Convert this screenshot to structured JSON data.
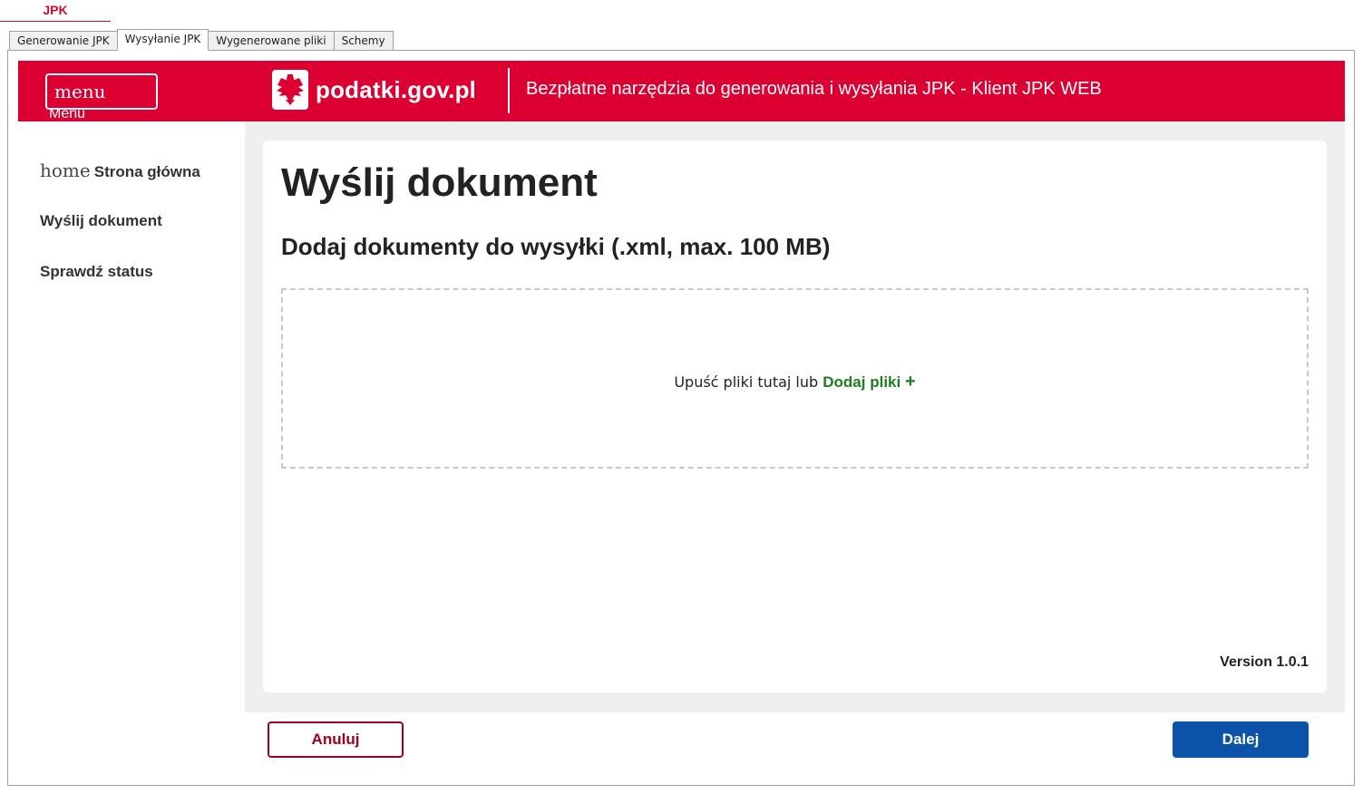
{
  "app_tab": {
    "label": "JPK"
  },
  "subtabs": [
    {
      "label": "Generowanie JPK"
    },
    {
      "label": "Wysyłanie JPK"
    },
    {
      "label": "Wygenerowane pliki"
    },
    {
      "label": "Schemy"
    }
  ],
  "header": {
    "menu_icon_text": "menu",
    "menu_label": "Menu",
    "logo_text": "podatki.gov.pl",
    "title": "Bezpłatne narzędzia do generowania i wysyłania JPK - Klient JPK WEB",
    "background_color": "#dc0032"
  },
  "sidebar": {
    "items": [
      {
        "icon_text": "home",
        "label": "Strona główna"
      },
      {
        "label": "Wyślij dokument"
      },
      {
        "label": "Sprawdź status"
      }
    ]
  },
  "main": {
    "title": "Wyślij dokument",
    "subtitle": "Dodaj dokumenty do wysyłki (.xml, max. 100 MB)",
    "dropzone": {
      "text": "Upuść pliki tutaj lub",
      "link_label": "Dodaj pliki",
      "link_color": "#1e7d1e"
    },
    "version": "Version 1.0.1"
  },
  "buttons": {
    "cancel_label": "Anuluj",
    "next_label": "Dalej",
    "next_color": "#0b53a8"
  }
}
